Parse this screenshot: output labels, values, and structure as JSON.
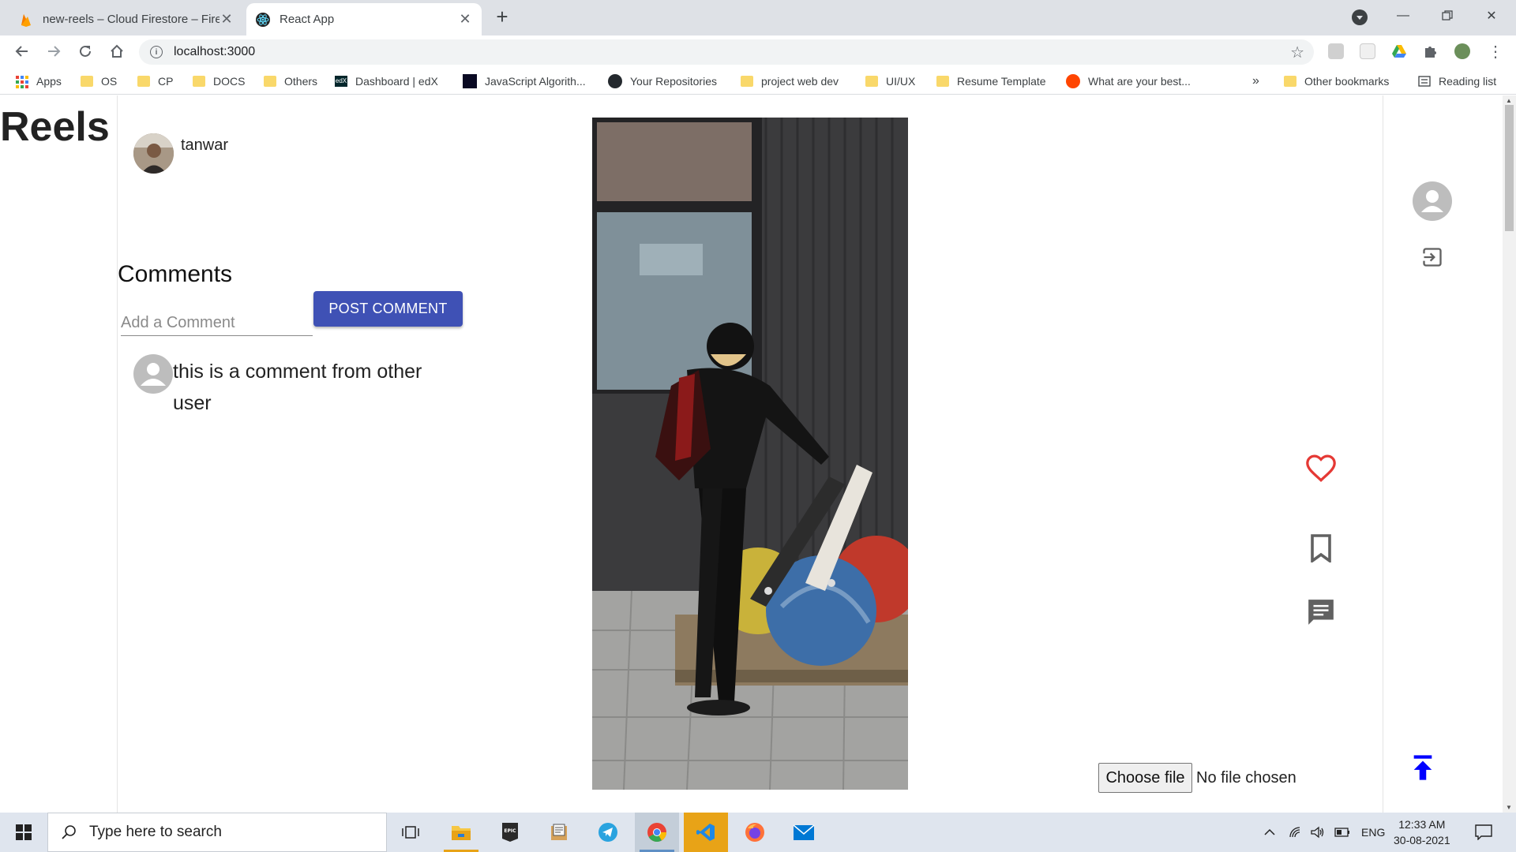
{
  "browser": {
    "tabs": [
      {
        "title": "new-reels – Cloud Firestore – Firebase console",
        "active": false
      },
      {
        "title": "React App",
        "active": true
      }
    ],
    "new_tab": "+",
    "url": "localhost:3000",
    "bookmarks": [
      {
        "label": "Apps",
        "icon": "apps-grid-icon"
      },
      {
        "label": "OS",
        "icon": "folder-icon"
      },
      {
        "label": "CP",
        "icon": "folder-icon"
      },
      {
        "label": "DOCS",
        "icon": "folder-icon"
      },
      {
        "label": "Others",
        "icon": "folder-icon"
      },
      {
        "label": "Dashboard | edX",
        "icon": "edx-icon"
      },
      {
        "label": "JavaScript Algorith...",
        "icon": "freecodecamp-icon"
      },
      {
        "label": "Your Repositories",
        "icon": "github-icon"
      },
      {
        "label": "project web dev",
        "icon": "folder-icon"
      },
      {
        "label": "UI/UX",
        "icon": "folder-icon"
      },
      {
        "label": "Resume Template",
        "icon": "folder-icon"
      },
      {
        "label": "What are your best...",
        "icon": "reddit-icon"
      }
    ],
    "overflow": "»",
    "other_bookmarks": "Other bookmarks",
    "reading_list": "Reading list"
  },
  "app": {
    "logo": "Reels",
    "post": {
      "username": "tanwar",
      "comments_title": "Comments",
      "comment_placeholder": "Add a Comment",
      "comment_value": "",
      "post_button": "POST COMMENT",
      "comments": [
        {
          "text": "this is a comment from other user"
        }
      ]
    },
    "actions": {
      "like_color": "#e53935",
      "icons": [
        "heart-outline-icon",
        "bookmark-outline-icon",
        "comment-icon"
      ]
    },
    "upload": {
      "button": "Choose file",
      "status": "No file chosen"
    },
    "sidebar": {
      "icons": [
        "account-circle-icon",
        "logout-icon"
      ],
      "scroll_top_color": "#0000ff"
    }
  },
  "taskbar": {
    "search_placeholder": "Type here to search",
    "language": "ENG",
    "time": "12:33 AM",
    "date": "30-08-2021",
    "apps": [
      "task-view-icon",
      "file-explorer-icon",
      "epic-games-icon",
      "notepad-icon",
      "telegram-icon",
      "chrome-icon",
      "vscode-icon",
      "firefox-icon",
      "mail-icon"
    ]
  }
}
